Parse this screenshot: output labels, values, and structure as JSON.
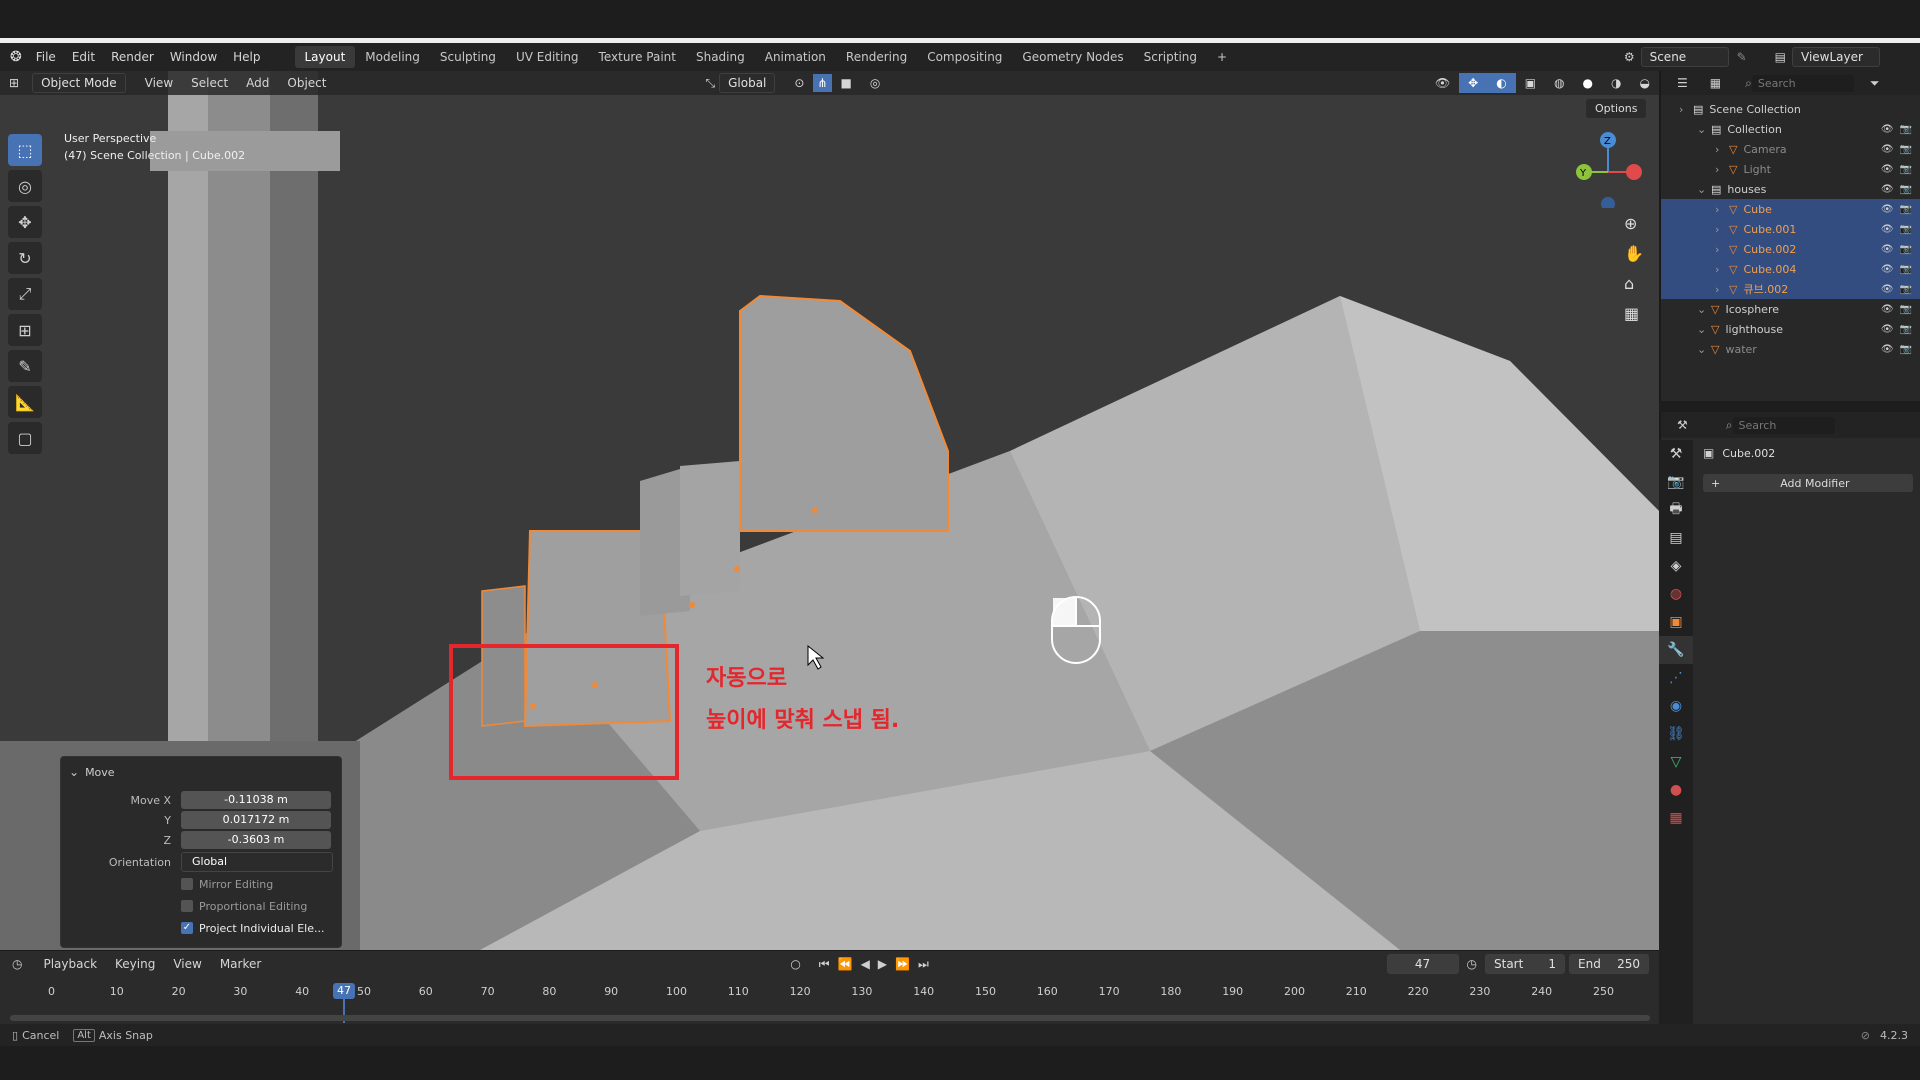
{
  "menubar": {
    "menus": [
      "File",
      "Edit",
      "Render",
      "Window",
      "Help"
    ],
    "workspaces": [
      "Layout",
      "Modeling",
      "Sculpting",
      "UV Editing",
      "Texture Paint",
      "Shading",
      "Animation",
      "Rendering",
      "Compositing",
      "Geometry Nodes",
      "Scripting"
    ],
    "active_workspace": "Layout",
    "scene": "Scene",
    "view_layer": "ViewLayer"
  },
  "viewport": {
    "mode": "Object Mode",
    "menus": [
      "View",
      "Select",
      "Add",
      "Object"
    ],
    "orientation": "Global",
    "options": "Options",
    "perspective": "User Perspective",
    "collection_info": "(47) Scene Collection | Cube.002",
    "gizmo_axes": [
      "X",
      "Y",
      "Z"
    ]
  },
  "move_panel": {
    "title": "Move",
    "move_x_label": "Move X",
    "move_x": "-0.11038 m",
    "y_label": "Y",
    "y": "0.017172 m",
    "z_label": "Z",
    "z": "-0.3603 m",
    "orientation_label": "Orientation",
    "orientation": "Global",
    "mirror_editing": "Mirror Editing",
    "proportional_editing": "Proportional Editing",
    "project_individual": "Project Individual Ele..."
  },
  "annotation": {
    "line1": "자동으로",
    "line2": "높이에 맞춰 스냅 됨."
  },
  "outliner": {
    "search_placeholder": "Search",
    "items": [
      {
        "label": "Scene Collection",
        "depth": 0,
        "selected": false
      },
      {
        "label": "Collection",
        "depth": 1,
        "selected": false
      },
      {
        "label": "Camera",
        "depth": 2,
        "selected": false
      },
      {
        "label": "Light",
        "depth": 2,
        "selected": false
      },
      {
        "label": "houses",
        "depth": 1,
        "selected": false
      },
      {
        "label": "Cube",
        "depth": 2,
        "selected": true
      },
      {
        "label": "Cube.001",
        "depth": 2,
        "selected": true
      },
      {
        "label": "Cube.002",
        "depth": 2,
        "selected": true
      },
      {
        "label": "Cube.004",
        "depth": 2,
        "selected": true
      },
      {
        "label": "큐브.002",
        "depth": 2,
        "selected": true
      },
      {
        "label": "Icosphere",
        "depth": 1,
        "selected": false
      },
      {
        "label": "lighthouse",
        "depth": 1,
        "selected": false
      },
      {
        "label": "water",
        "depth": 1,
        "selected": false
      }
    ]
  },
  "properties": {
    "search_placeholder": "Search",
    "object_name": "Cube.002",
    "add_modifier": "Add Modifier"
  },
  "timeline": {
    "menus": [
      "Playback",
      "Keying",
      "View",
      "Marker"
    ],
    "current_frame": "47",
    "start_label": "Start",
    "start": "1",
    "end_label": "End",
    "end": "250",
    "ticks": [
      "0",
      "10",
      "20",
      "30",
      "40",
      "50",
      "60",
      "70",
      "80",
      "90",
      "100",
      "110",
      "120",
      "130",
      "140",
      "150",
      "160",
      "170",
      "180",
      "190",
      "200",
      "210",
      "220",
      "230",
      "240",
      "250"
    ]
  },
  "statusbar": {
    "cancel": "Cancel",
    "alt_key": "Alt",
    "axis_snap": "Axis Snap",
    "version": "4.2.3"
  },
  "colors": {
    "accent": "#4772b3",
    "selection_orange": "#f08a38",
    "annotation_red": "#e4262d"
  }
}
